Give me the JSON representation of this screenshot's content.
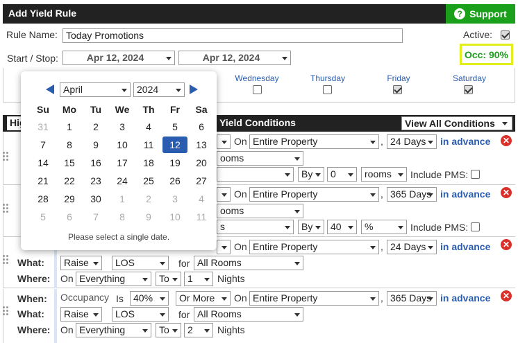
{
  "header": {
    "title": "Add Yield Rule",
    "support_label": "Support",
    "support_icon": "question-icon"
  },
  "form": {
    "rule_name_label": "Rule Name:",
    "rule_name_value": "Today Promotions",
    "active_label": "Active:",
    "active_checked": true,
    "start_stop_label": "Start / Stop:",
    "start_date": "Apr 12, 2024",
    "stop_date": "Apr 12, 2024",
    "occ_label": "Occ: 90%"
  },
  "days": [
    {
      "label": "Wednesday",
      "checked": false
    },
    {
      "label": "Thursday",
      "checked": false
    },
    {
      "label": "Friday",
      "checked": true
    },
    {
      "label": "Saturday",
      "checked": true
    }
  ],
  "conditions_bar": {
    "left_label": "Hig",
    "title": "Yield Conditions",
    "view_select": "View All Conditions"
  },
  "rules": [
    {
      "r1_prop_on": "On",
      "r1_property": "Entire Property",
      "r1_comma": ",",
      "r1_days": "24 Days",
      "r1_adv": "in advance",
      "r1_rooms_suffix": "ooms",
      "r1_by": "By",
      "r1_by_val": "0",
      "r1_unit": "rooms",
      "r1_pms": "Include PMS:"
    }
  ],
  "rule1": {
    "on": "On",
    "property": "Entire Property",
    "comma": ",",
    "days": "24 Days",
    "advance": "in advance",
    "rooms_frag": "ooms",
    "by": "By",
    "by_val": "0",
    "unit": "rooms",
    "include_pms": "Include PMS:"
  },
  "rule2": {
    "on": "On",
    "property": "Entire Property",
    "comma": ",",
    "days": "365 Days",
    "advance": "in advance",
    "rooms_frag": "ooms",
    "s_frag": "s",
    "by": "By",
    "by_val": "40",
    "unit": "%",
    "include_pms": "Include PMS:"
  },
  "rule3": {
    "on": "On",
    "property": "Entire Property",
    "comma": ",",
    "days": "24 Days",
    "advance": "in advance",
    "what_label": "What:",
    "action": "Raise",
    "type": "LOS",
    "for_label": "for",
    "for_value": "All Rooms",
    "where_label": "Where:",
    "where_on": "On",
    "where_scope": "Everything",
    "to": "To",
    "nights_val": "1",
    "nights": "Nights"
  },
  "rule4": {
    "when_label": "When:",
    "metric": "Occupancy",
    "is": "Is",
    "pct": "40%",
    "cmp": "Or More",
    "on": "On",
    "property": "Entire Property",
    "comma": ",",
    "days": "365 Days",
    "advance": "in advance",
    "what_label": "What:",
    "action": "Raise",
    "type": "LOS",
    "for_label": "for",
    "for_value": "All Rooms",
    "where_label": "Where:",
    "where_on": "On",
    "where_scope": "Everything",
    "to": "To",
    "nights_val": "2",
    "nights": "Nights"
  },
  "row_fragment_s": "s",
  "calendar": {
    "month": "April",
    "year": "2024",
    "dow": [
      "Su",
      "Mo",
      "Tu",
      "We",
      "Th",
      "Fr",
      "Sa"
    ],
    "weeks": [
      [
        "31",
        "1",
        "2",
        "3",
        "4",
        "5",
        "6"
      ],
      [
        "7",
        "8",
        "9",
        "10",
        "11",
        "12",
        "13"
      ],
      [
        "14",
        "15",
        "16",
        "17",
        "18",
        "19",
        "20"
      ],
      [
        "21",
        "22",
        "23",
        "24",
        "25",
        "26",
        "27"
      ],
      [
        "28",
        "29",
        "30",
        "1",
        "2",
        "3",
        "4"
      ],
      [
        "5",
        "6",
        "7",
        "8",
        "9",
        "10",
        "11"
      ]
    ],
    "selected": "12",
    "note": "Please select a single date."
  }
}
